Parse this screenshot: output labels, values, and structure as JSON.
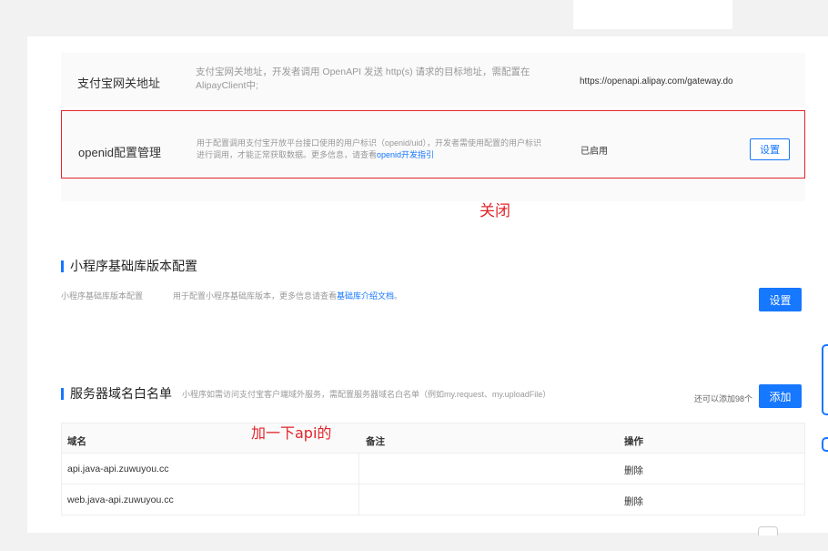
{
  "gateway": {
    "name": "支付宝网关地址",
    "desc": "支付宝网关地址，开发者调用 OpenAPI 发送 http(s) 请求的目标地址，需配置在 AlipayClient中;",
    "value": "https://openapi.alipay.com/gateway.do"
  },
  "openid": {
    "name": "openid配置管理",
    "desc": "用于配置调用支付宝开放平台接口使用的用户标识（openid/uid），开发者需使用配置的用户标识进行调用，才能正常获取数据。更多信息，请查看",
    "desc_link": "openid开发指引",
    "value": "已启用",
    "button": "设置"
  },
  "annotations": {
    "close": "关闭",
    "add_api": "加一下api的"
  },
  "lib_section": {
    "title": "小程序基础库版本配置",
    "item_name": "小程序基础库版本配置",
    "item_desc": "用于配置小程序基础库版本，更多信息请查看",
    "item_link": "基础库介绍文档",
    "item_desc_end": "。",
    "button": "设置"
  },
  "whitelist_section": {
    "title": "服务器域名白名单",
    "subtitle": "小程序如需访问支付宝客户端域外服务，需配置服务器域名白名单（例如my.request、my.uploadFile）",
    "remaining": "还可以添加98个",
    "add_button": "添加",
    "columns": [
      "域名",
      "备注",
      "操作"
    ],
    "rows": [
      {
        "domain": "api.java-api.zuwuyou.cc",
        "note": "",
        "action": "删除"
      },
      {
        "domain": "web.java-api.zuwuyou.cc",
        "note": "",
        "action": "删除"
      }
    ]
  }
}
